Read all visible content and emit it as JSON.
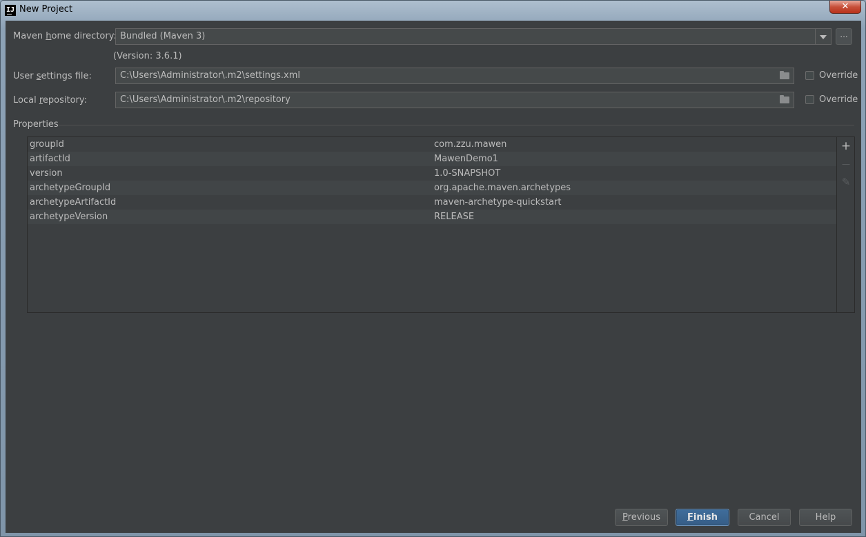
{
  "window": {
    "title": "New Project",
    "close_glyph": "✕"
  },
  "maven": {
    "home_label_pre": "Maven ",
    "home_label_u": "h",
    "home_label_post": "ome directory:",
    "home_value": "Bundled (Maven 3)",
    "browse_label": "...",
    "version_text": "(Version: 3.6.1)"
  },
  "settings": {
    "label_pre": "User ",
    "label_u": "s",
    "label_post": "ettings file:",
    "value": "C:\\Users\\Administrator\\.m2\\settings.xml",
    "override_label": "Override"
  },
  "repository": {
    "label_pre": "Local ",
    "label_u": "r",
    "label_post": "epository:",
    "value": "C:\\Users\\Administrator\\.m2\\repository",
    "override_label": "Override"
  },
  "properties": {
    "title": "Properties",
    "rows": [
      {
        "key": "groupId",
        "value": "com.zzu.mawen"
      },
      {
        "key": "artifactId",
        "value": "MawenDemo1"
      },
      {
        "key": "version",
        "value": "1.0-SNAPSHOT"
      },
      {
        "key": "archetypeGroupId",
        "value": "org.apache.maven.archetypes"
      },
      {
        "key": "archetypeArtifactId",
        "value": "maven-archetype-quickstart"
      },
      {
        "key": "archetypeVersion",
        "value": "RELEASE"
      }
    ],
    "tools": {
      "add": "+",
      "remove": "—",
      "edit": "✎"
    }
  },
  "buttons": {
    "previous_u": "P",
    "previous_rest": "revious",
    "finish_u": "F",
    "finish_rest": "inish",
    "cancel": "Cancel",
    "help": "Help"
  },
  "icons": {
    "app": "intellij-icon",
    "folder": "folder-icon",
    "dropdown": "chevron-down-icon"
  }
}
